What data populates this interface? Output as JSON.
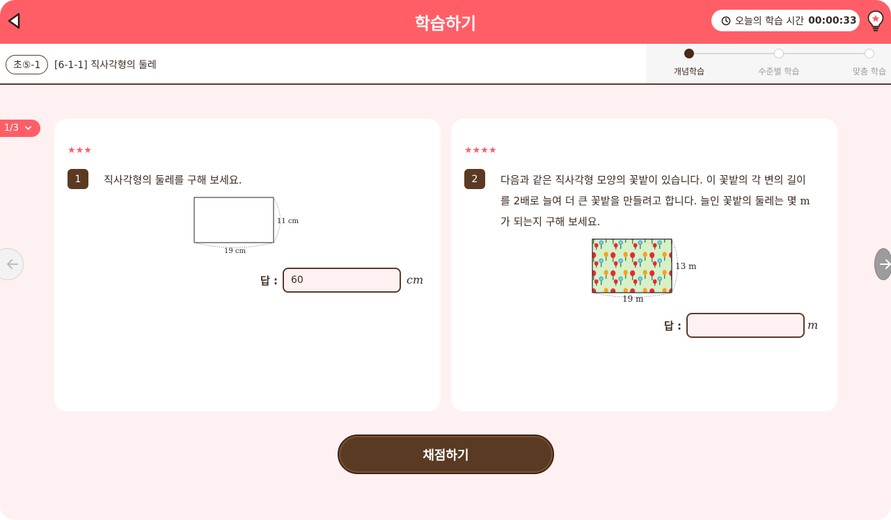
{
  "header": {
    "title": "학습하기",
    "timer_label": "오늘의 학습 시간",
    "timer_value": "00:00:33",
    "accent_color": "#ff5e67"
  },
  "icons": {
    "back": "back-arrow-icon",
    "clock": "clock-icon",
    "hint": "lightbulb-icon",
    "page_toggle": "chevron-down-icon",
    "prev": "arrow-left-icon",
    "next": "arrow-right-icon"
  },
  "subbar": {
    "grade": "초⑤-1",
    "unit_title": "[6-1-1] 직사각형의 둘레",
    "steps": [
      {
        "label": "개념학습",
        "active": true
      },
      {
        "label": "수준별 학습",
        "active": false
      },
      {
        "label": "맞춤 학습",
        "active": false
      }
    ]
  },
  "pager": {
    "current": "1/3"
  },
  "questions": [
    {
      "number": "1",
      "stars": "★★★",
      "text": "직사각형의 둘레를 구해 보세요.",
      "width_label": "19 cm",
      "height_label": "11 cm",
      "answer_label": "답 :",
      "answer_value": "60",
      "answer_unit": "cm"
    },
    {
      "number": "2",
      "stars": "★★★★",
      "text_line1": "다음과 같은 직사각형 모양의 꽃밭이 있습니다. 이 꽃밭의 각 변의 길이",
      "text_line2_pre": "를 2배로 늘여 더 큰 꽃밭을 만들려고 합니다. 늘인 꽃밭의 둘레는 몇 ",
      "text_line2_unit": "m",
      "text_line3": "가 되는지 구해 보세요.",
      "width_label": "19 m",
      "height_label": "13 m",
      "answer_label": "답 :",
      "answer_value": "",
      "answer_unit": "m"
    }
  ],
  "grade_button": {
    "label": "채점하기"
  }
}
